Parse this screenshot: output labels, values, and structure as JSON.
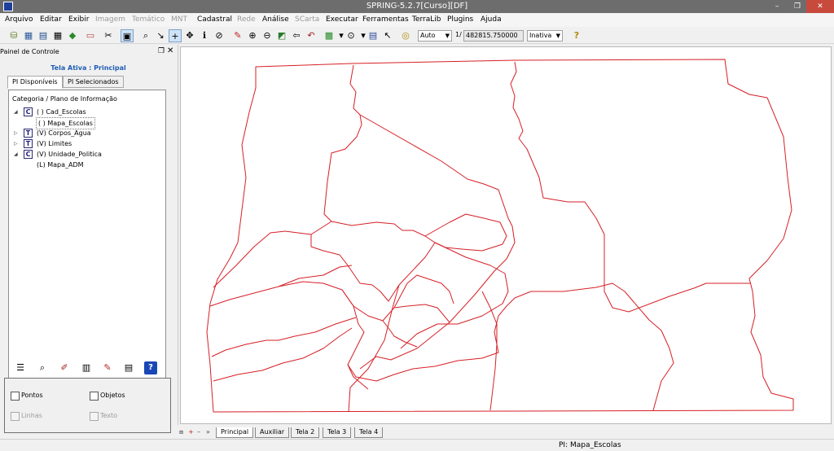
{
  "window": {
    "title": "SPRING-5.2.7[Curso][DF]",
    "min": "–",
    "max": "❐",
    "close": "✕"
  },
  "menu": [
    "Arquivo",
    "Editar",
    "Exibir",
    "Imagem",
    "Temático",
    "MNT",
    "Cadastral",
    "Rede",
    "Análise",
    "SCarta",
    "Executar",
    "Ferramentas",
    "TerraLib",
    "Plugins",
    "Ajuda"
  ],
  "menu_disabled": [
    "Imagem",
    "Temático",
    "MNT",
    "Rede",
    "SCarta"
  ],
  "toolbar": {
    "zoom_mode": "Auto",
    "scale_prefix": "1/",
    "scale_value": "482815.750000",
    "state": "Inativa"
  },
  "panel": {
    "title": "Painel de Controle",
    "float_icon": "❐",
    "close_icon": "✕",
    "active_screen": "Tela Ativa : Principal",
    "tabs": [
      "PI Disponíveis",
      "PI Selecionados"
    ],
    "tree_header": "Categoria / Plano de Informação",
    "tree": [
      {
        "arrow": "◢",
        "type": "C",
        "label": "( ) Cad_Escolas"
      },
      {
        "arrow": "",
        "type": "",
        "label": "( ) Mapa_Escolas"
      },
      {
        "arrow": "▷",
        "type": "T",
        "label": "(V) Corpos_Agua"
      },
      {
        "arrow": "▷",
        "type": "T",
        "label": "(V) Limites"
      },
      {
        "arrow": "◢",
        "type": "C",
        "label": "(V) Unidade_Politica"
      },
      {
        "arrow": "",
        "type": "",
        "label": "(L) Mapa_ADM"
      }
    ],
    "checks": {
      "pontos": "Pontos",
      "objetos": "Objetos",
      "linhas": "Linhas",
      "texto": "Texto"
    },
    "help_label": "?"
  },
  "screen_tabs": [
    "Principal",
    "Auxiliar",
    "Tela 2",
    "Tela 3",
    "Tela 4"
  ],
  "nav_buttons": [
    "⧈",
    "+",
    "–",
    "»"
  ],
  "status": "PI: Mapa_Escolas",
  "colors": {
    "map_line": "#d61f26",
    "title_bg": "#6d6d6d",
    "accent": "#1f5db5"
  }
}
